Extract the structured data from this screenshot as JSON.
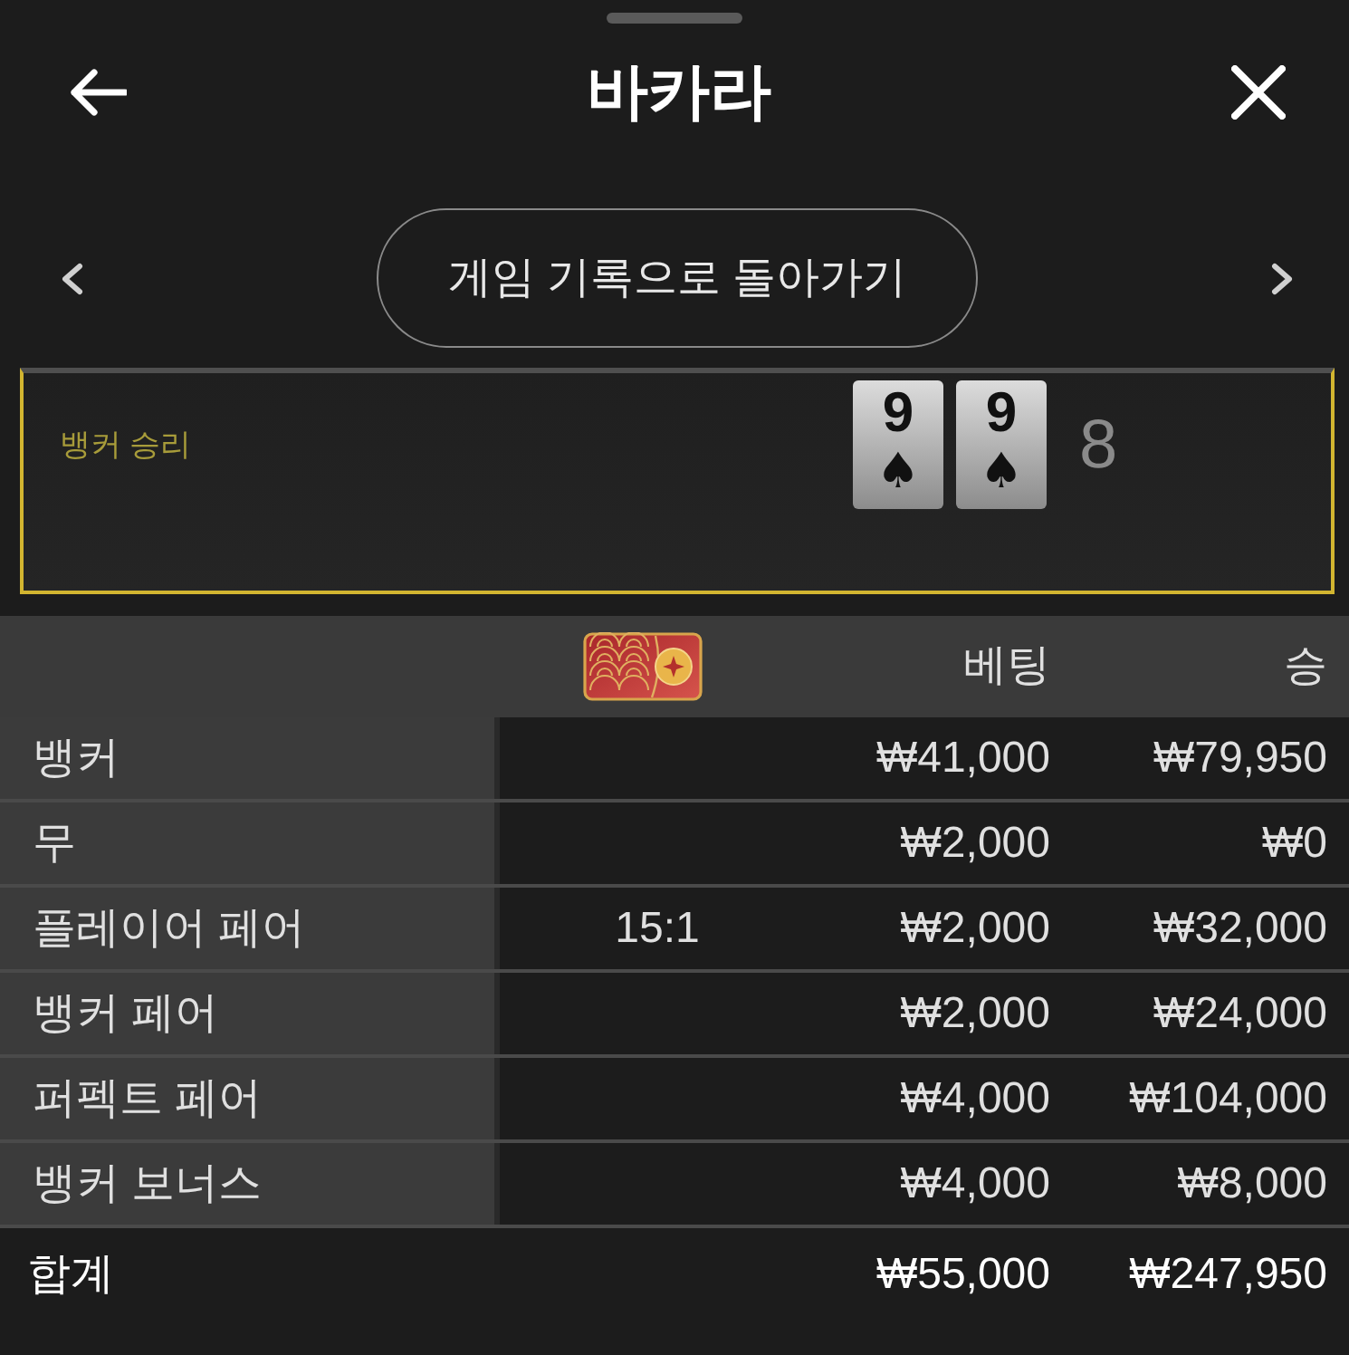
{
  "header": {
    "title": "바카라"
  },
  "history_button": {
    "label": "게임 기록으로 돌아가기"
  },
  "result": {
    "outcome": "뱅커 승리",
    "cards": [
      {
        "rank": "9",
        "suit": "♠"
      },
      {
        "rank": "9",
        "suit": "♠"
      }
    ],
    "score": "8"
  },
  "table": {
    "columns": [
      {
        "kind": "icon"
      },
      {
        "kind": "text",
        "label": "베팅"
      },
      {
        "kind": "text",
        "label": "승"
      }
    ],
    "rows": [
      {
        "label": "뱅커",
        "bet": "₩41,000",
        "win": "₩79,950"
      },
      {
        "label": "무",
        "bet": "₩2,000",
        "win": "₩0"
      },
      {
        "label": "플레이어 페어",
        "odds": "15:1",
        "bet": "₩2,000",
        "win": "₩32,000"
      },
      {
        "label": "뱅커 페어",
        "bet": "₩2,000",
        "win": "₩24,000"
      },
      {
        "label": "퍼펙트 페어",
        "bet": "₩4,000",
        "win": "₩104,000"
      },
      {
        "label": "뱅커 보너스",
        "bet": "₩4,000",
        "win": "₩8,000"
      }
    ],
    "total": {
      "label": "합계",
      "bet": "₩55,000",
      "win": "₩247,950"
    }
  }
}
